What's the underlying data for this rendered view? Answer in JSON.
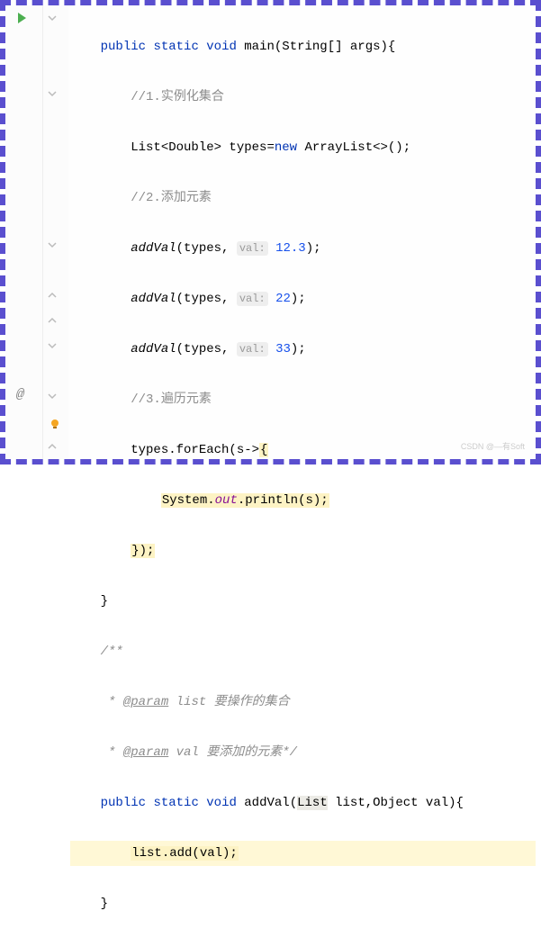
{
  "code": {
    "sig_public": "public",
    "sig_static": "static",
    "sig_void": "void",
    "main": "main",
    "main_params": "(String[] args){",
    "c1": "//1.实例化集合",
    "list_decl_1": "List<Double> types=",
    "new_kw": "new",
    "list_decl_2": " ArrayList<>();",
    "c2": "//2.添加元素",
    "addVal": "addVal",
    "call_open": "(types, ",
    "hint_val": "val:",
    "v1": "12.3",
    "v2": "22",
    "v3": "33",
    "call_close": ");",
    "c3": "//3.遍历元素",
    "foreach_pre": "types.forEach(s->",
    "foreach_brace": "{",
    "sys": "System.",
    "out": "out",
    "println": ".println(s);",
    "lam_close": "});",
    "brace_close": "}",
    "doc_open": "/**",
    "doc_star": " * ",
    "doc_param": "@param",
    "doc_p1_name": " list",
    "doc_p1_desc": " 要操作的集合",
    "doc_p2_name": " val",
    "doc_p2_desc": " 要添加的元素*/",
    "addVal_def": "addVal",
    "addVal_params_1": "(",
    "addVal_list_t": "List",
    "addVal_params_2": " list,Object val){",
    "body_call": "list.add(val);",
    "brace_close2": "}"
  },
  "watermark": "CSDN @—有Soft"
}
